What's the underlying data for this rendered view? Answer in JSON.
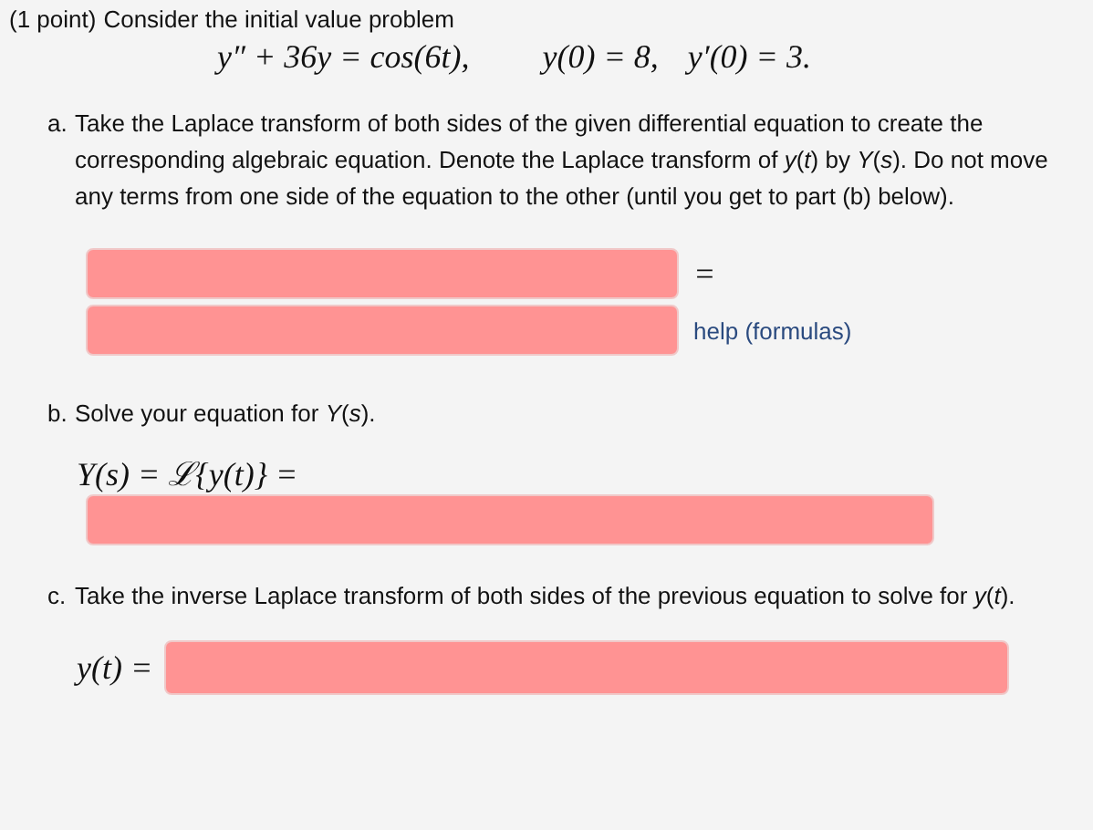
{
  "problem": {
    "points": "(1 point)",
    "intro": "Consider the initial value problem",
    "equation": [
      "y″ + 36y = cos(6t),",
      "y(0) = 8,",
      "y′(0) = 3."
    ]
  },
  "part_a": {
    "marker": "a.",
    "text": "Take the Laplace transform of both sides of the given differential equation to create the corresponding algebraic equation. Denote the Laplace transform of *y*(*t*) by *Y*(*s*). Do not move any terms from one side of the equation to the other (until you get to part (b) below).",
    "fields": [
      {
        "incorrect": true
      },
      {
        "incorrect": true
      }
    ],
    "equals": "=",
    "help_link": "help (formulas)"
  },
  "part_b": {
    "marker": "b.",
    "text": "Solve your equation for *Y*(*s*).",
    "formula": "Y(s) = ℒ{y(t)} =",
    "field": {
      "incorrect": true
    }
  },
  "part_c": {
    "marker": "c.",
    "text": "Take the inverse Laplace transform of both sides of the previous equation to solve for *y*(*t*).",
    "formula": "y(t) =",
    "field": {
      "incorrect": true
    }
  }
}
